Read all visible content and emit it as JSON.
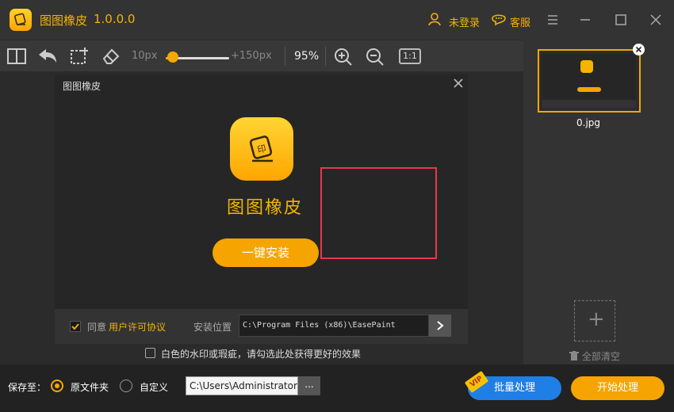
{
  "app": {
    "title": "图图橡皮",
    "version": "1.0.0.0",
    "login_label": "未登录",
    "service_label": "客服"
  },
  "toolbar": {
    "brush_min": "10px",
    "brush_max": "+150px",
    "brush_level": 0.03,
    "zoom": "95%",
    "one_to_one": "1:1"
  },
  "dialog": {
    "title": "图图橡皮",
    "product_name": "图图橡皮",
    "install_button": "一键安装",
    "agree_prefix": "同意",
    "agree_link": "用户许可协议",
    "location_label": "安装位置",
    "location_value": "C:\\Program Files (x86)\\EasePaint"
  },
  "watermark_option": "白色的水印或瑕疵，请勾选此处获得更好的效果",
  "right_panel": {
    "thumbnail_name": "0.jpg",
    "add_symbol": "+",
    "clear_all": "全部清空"
  },
  "bottom": {
    "save_to": "保存至：",
    "option_original": "原文件夹",
    "option_custom": "自定义",
    "path": "C:\\Users\\Administrator",
    "browse": "...",
    "vip": "VIP",
    "batch_button": "批量处理",
    "start_button": "开始处理"
  },
  "colors": {
    "accent": "#f5a400",
    "batch_blue": "#1f7fe5",
    "selection_red": "#e8384c"
  }
}
